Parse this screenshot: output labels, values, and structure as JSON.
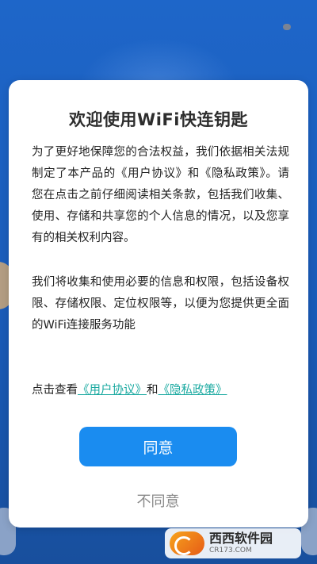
{
  "dialog": {
    "title": "欢迎使用WiFi快连钥匙",
    "paragraph1": "为了更好地保障您的合法权益，我们依据相关法规制定了本产品的《用户协议》和《隐私政策》。请您在点击之前仔细阅读相关条款，包括我们收集、使用、存储和共享您的个人信息的情况，以及您享有的相关权利内容。",
    "paragraph2": "我们将收集和使用必要的信息和权限，包括设备权限、存储权限、定位权限等，以便为您提供更全面的WiFi连接服务功能",
    "links_prefix": "点击查看",
    "user_agreement_link": "《用户协议》",
    "links_and": "和",
    "privacy_policy_link": "《隐私政策》",
    "agree_label": "同意",
    "disagree_label": "不同意"
  },
  "watermark": {
    "main": "西西软件园",
    "sub": "CR173.COM"
  },
  "colors": {
    "background": "#1e66c9",
    "agree_button": "#1a8cf0",
    "link": "#19a9a0",
    "disagree_text": "#8a8a8a"
  }
}
